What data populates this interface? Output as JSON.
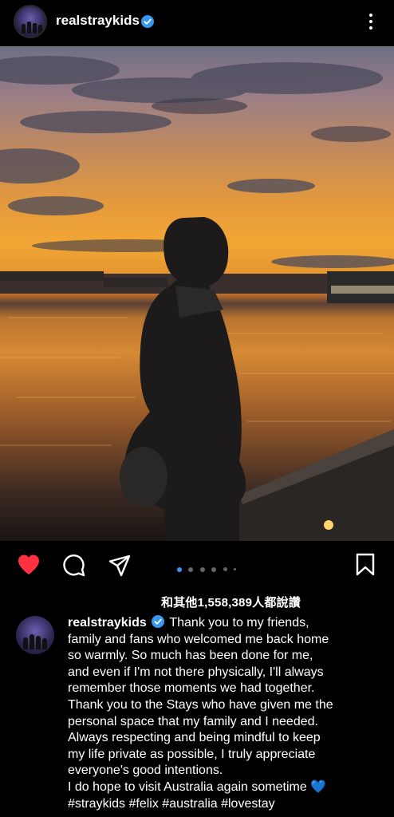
{
  "header": {
    "username": "realstraykids",
    "verified_icon": "verified-badge-icon",
    "more_icon": "more-vertical-icon"
  },
  "post": {
    "image_alt_icon": "photo",
    "carousel": {
      "count": 6,
      "active_index": 0
    }
  },
  "actions": {
    "like_icon": "heart-icon",
    "liked": true,
    "comment_icon": "comment-icon",
    "share_icon": "share-icon",
    "save_icon": "bookmark-icon"
  },
  "likes_text": "和其他1,558,389人都說讚",
  "caption": {
    "username": "realstraykids",
    "lines": [
      "Thank you to my friends,",
      "family and fans who welcomed me back home",
      "so warmly. So much has been done for me,",
      "and even if I'm not there physically, I'll always",
      "remember those moments we had together.",
      "Thank you to the Stays who have given me the",
      "personal space that my family and I needed.",
      "Always respecting and being mindful to keep",
      "my life private as possible, I truly appreciate",
      "everyone's good intentions.",
      "I do hope to visit Australia again sometime",
      "#straykids #felix #australia #lovestay"
    ],
    "heart_emoji": "💙"
  },
  "colors": {
    "background": "#000000",
    "like_red": "#ff3040",
    "verified_blue": "#3897f0",
    "carousel_active": "#3897f0"
  }
}
